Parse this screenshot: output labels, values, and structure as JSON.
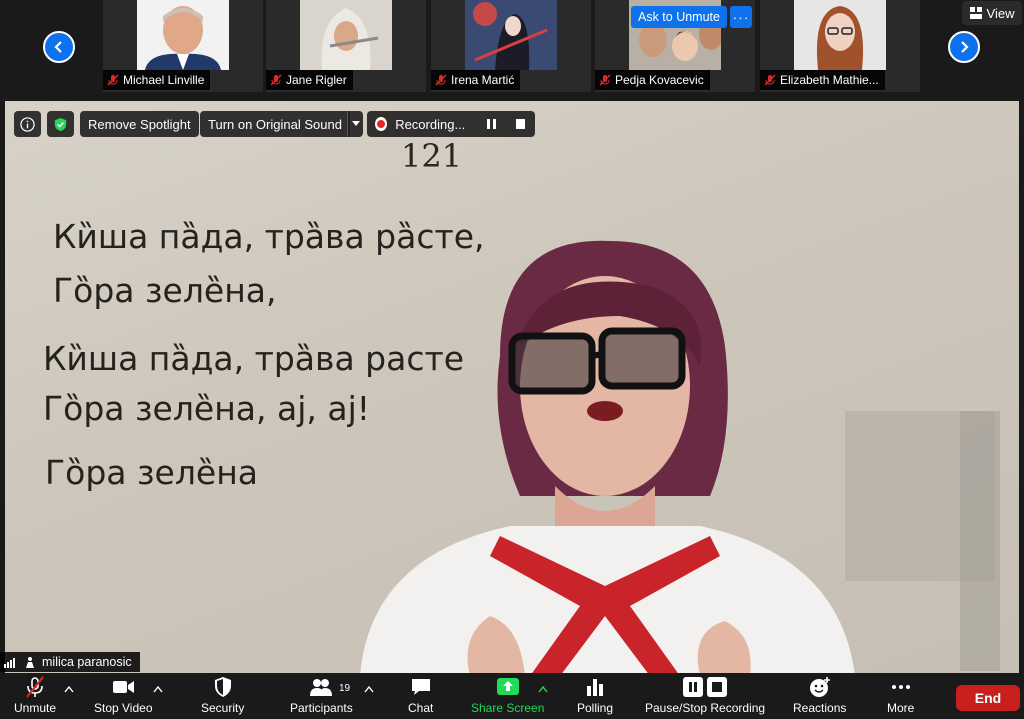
{
  "gallery": {
    "view_label": "View",
    "participants": [
      {
        "name": "Michael Linville"
      },
      {
        "name": "Jane Rigler"
      },
      {
        "name": "Irena Martić"
      },
      {
        "name": "Pedja Kovacevic"
      },
      {
        "name": "Elizabeth Mathie..."
      }
    ],
    "ask_to_unmute": "Ask to Unmute",
    "more": "···"
  },
  "overlay": {
    "remove_spotlight": "Remove Spotlight",
    "original_sound": "Turn on Original Sound",
    "recording": "Recording..."
  },
  "main_video": {
    "page_number": "121",
    "lyrics": [
      "Ки̏ша па̏да, тра̏ва ра̏сте,",
      "Го̏ра зеле̏на,",
      "Ки̏ша па̏да, тра̏ва расте",
      "Го̏ра зеле̏на, aj, aj!",
      "Го̏ра зеле̏на"
    ],
    "speaker_name": "milica paranosic"
  },
  "toolbar": {
    "unmute": "Unmute",
    "stop_video": "Stop Video",
    "security": "Security",
    "participants": "Participants",
    "participants_count": "19",
    "chat": "Chat",
    "share_screen": "Share Screen",
    "polling": "Polling",
    "pause_stop_recording": "Pause/Stop Recording",
    "reactions": "Reactions",
    "more": "More",
    "end": "End"
  },
  "colors": {
    "accent_blue": "#0e72ed",
    "share_green": "#23d959",
    "end_red": "#c8201c",
    "record_red": "#e02828"
  }
}
